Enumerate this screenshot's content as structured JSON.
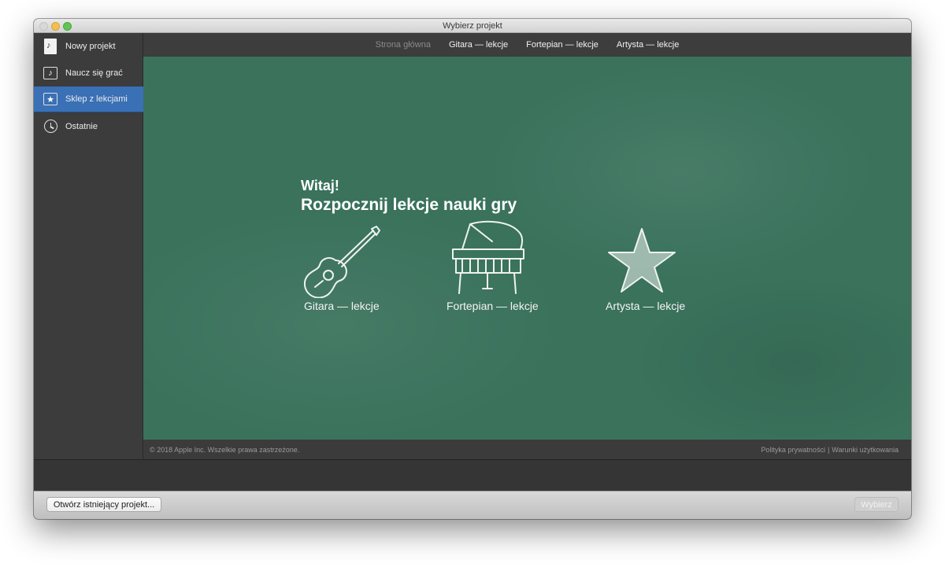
{
  "window": {
    "title": "Wybierz projekt"
  },
  "sidebar": {
    "items": [
      {
        "label": "Nowy projekt",
        "icon": "new-project-icon"
      },
      {
        "label": "Naucz się grać",
        "icon": "music-note-icon"
      },
      {
        "label": "Sklep z lekcjami",
        "icon": "star-icon",
        "active": true
      },
      {
        "label": "Ostatnie",
        "icon": "clock-icon"
      }
    ]
  },
  "nav": {
    "tabs": [
      {
        "label": "Strona główna",
        "dim": true
      },
      {
        "label": "Gitara — lekcje"
      },
      {
        "label": "Fortepian — lekcje"
      },
      {
        "label": "Artysta — lekcje"
      }
    ]
  },
  "hero": {
    "greeting": "Witaj!",
    "headline": "Rozpocznij lekcje nauki gry",
    "lessons": [
      {
        "label": "Gitara — lekcje",
        "icon": "guitar-icon"
      },
      {
        "label": "Fortepian — lekcje",
        "icon": "piano-icon"
      },
      {
        "label": "Artysta — lekcje",
        "icon": "star-icon"
      }
    ]
  },
  "footer": {
    "copyright": "© 2018 Apple Inc. Wszelkie prawa zastrzeżone.",
    "privacy": "Polityka prywatności",
    "separator": "|",
    "terms": "Warunki użytkowania"
  },
  "bottombar": {
    "open_label": "Otwórz istniejący projekt...",
    "choose_label": "Wybierz"
  },
  "colors": {
    "chalkboard": "#3a725c",
    "active": "#3a70b6"
  }
}
